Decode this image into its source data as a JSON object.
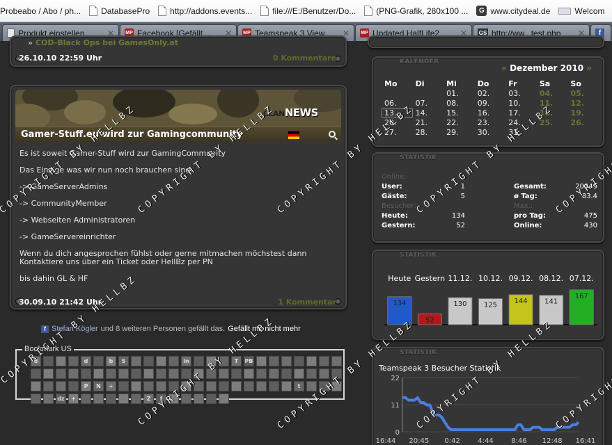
{
  "browser": {
    "bookmarks": [
      {
        "label": "Probeabo / Abo / ph...",
        "icon": "none"
      },
      {
        "label": "DatabasePro",
        "icon": "page"
      },
      {
        "label": "http://addons.events...",
        "icon": "page"
      },
      {
        "label": "file:///E:/Benutzer/Do...",
        "icon": "page"
      },
      {
        "label": "(PNG-Grafik, 280x100 ...",
        "icon": "page"
      },
      {
        "label": "www.citydeal.de",
        "icon": "g"
      },
      {
        "label": "Welcom",
        "icon": "cd"
      }
    ],
    "tabs": [
      {
        "label": "Produkt einstellen...",
        "favicon": "doc-icon"
      },
      {
        "label": "Facebook [Gefällt ...",
        "favicon": "mp-icon"
      },
      {
        "label": "Teamspeak 3 View...",
        "favicon": "mp-icon"
      },
      {
        "label": "Updated HalfLife2...",
        "favicon": "mp-icon"
      },
      {
        "label": "http://ww...test.php",
        "favicon": "gs-icon"
      },
      {
        "label": "",
        "favicon": "fb-icon"
      }
    ]
  },
  "news_top": {
    "link_arrow": "»",
    "link_text": "COD-Black Ops bei GamesOnly.at",
    "date": "26.10.10 22:59 Uhr",
    "comments": "0 Kommentare"
  },
  "news_main": {
    "logo_clan": "CLAN",
    "logo_news": "NEWS",
    "title": "Gamer-Stuff.eu wird zur Gamingcommunity",
    "body": [
      "Es ist soweit Gamer-Stuff wird zur GamingCommunity",
      "Das Einzige was wir nun noch brauchen sind:",
      "-> GameServerAdmins",
      "-> CommunityMember",
      "-> Webseiten Administratoren",
      "-> GameServereinrichter",
      "Wenn du dich angesprochen fühlst oder gerne mitmachen möchstest dann Kontaktiere uns über ein Ticket oder HellBz per PN",
      "bis dahin GL & HF"
    ],
    "date": "30.09.10 21:42 Uhr",
    "comments": "1 Kommentar"
  },
  "facebook": {
    "user": "Stefan Kögler",
    "text": "und 8 weiteren Personen gefällt das.",
    "unlike": "Gefällt mir nicht mehr"
  },
  "bookmark_us": {
    "title": "Bookmark US",
    "icons": [
      "d",
      "",
      "",
      "",
      "d",
      "",
      "b",
      "S",
      "",
      "",
      "",
      "",
      "in",
      "",
      "",
      "",
      "T",
      "PB",
      "",
      "",
      "",
      "",
      "",
      "",
      "",
      "",
      "",
      "",
      "",
      "",
      "",
      "",
      "",
      "",
      "",
      "",
      "",
      "",
      "",
      "",
      "",
      "",
      "",
      "",
      "",
      "",
      "",
      "",
      "",
      "",
      "",
      "",
      "",
      "",
      "P",
      "N",
      "+",
      "",
      "",
      "",
      "",
      "",
      "",
      "",
      "",
      "",
      "",
      "",
      "",
      "",
      "",
      "t",
      "",
      "",
      "",
      "",
      "",
      "dz",
      "+",
      "",
      "",
      "",
      "",
      "",
      "Z",
      "f",
      "",
      "",
      "",
      "",
      ""
    ]
  },
  "calendar": {
    "heading": "KALENDER",
    "prev": "«",
    "month": "Dezember 2010",
    "next": "»",
    "days": [
      "Mo",
      "Di",
      "Mi",
      "Do",
      "Fr",
      "Sa",
      "So"
    ],
    "weeks": [
      [
        "",
        "",
        "01.",
        "02.",
        "03.",
        "04.",
        "05."
      ],
      [
        "06.",
        "07.",
        "08.",
        "09.",
        "10.",
        "11.",
        "12."
      ],
      [
        "13.",
        "14.",
        "15.",
        "16.",
        "17.",
        "18.",
        "19."
      ],
      [
        "20.",
        "21.",
        "22.",
        "23.",
        "24.",
        "25.",
        "26."
      ],
      [
        "27.",
        "28.",
        "29.",
        "30.",
        "31.",
        "",
        ""
      ]
    ]
  },
  "statistik1": {
    "heading": "STATISTIK",
    "online_label": "Online:",
    "user_label": "User:",
    "user": "1",
    "gesamt_label": "Gesamt:",
    "gesamt": "20849",
    "gaeste_label": "Gäste:",
    "gaeste": "5",
    "tag_label": "ø Tag:",
    "tag": "83.4",
    "besucher_label": "Besucher:",
    "max_label": "Max.:",
    "heute_label": "Heute:",
    "heute": "134",
    "protag_label": "pro Tag:",
    "protag": "475",
    "gestern_label": "Gestern:",
    "gestern": "52",
    "maxonline_label": "Online:",
    "maxonline": "430"
  },
  "statistik2": {
    "heading": "STATISTIK"
  },
  "statistik3": {
    "heading": "STATISTIK"
  },
  "chart_data": [
    {
      "type": "bar",
      "categories": [
        "Heute",
        "Gestern",
        "11.12.",
        "10.12.",
        "09.12.",
        "08.12.",
        "07.12."
      ],
      "values": [
        134,
        52,
        130,
        125,
        144,
        141,
        167
      ],
      "colors": [
        "#1e5bc8",
        "#b01a1a",
        "#c8c8c8",
        "#c8c8c8",
        "#c4c41c",
        "#c8c8c8",
        "#22b022"
      ],
      "ylim": [
        0,
        180
      ]
    },
    {
      "type": "line",
      "title": "Teamspeak 3 Besucher Statistik",
      "x_ticks": [
        "16:44",
        "20:45",
        "0:42",
        "4:44",
        "8:46",
        "12:48",
        "16:41"
      ],
      "y_ticks": [
        22,
        11,
        0
      ],
      "ylim": [
        0,
        22
      ],
      "values": [
        13,
        13,
        12,
        12,
        12,
        13,
        11,
        11,
        10,
        10,
        7,
        6,
        6,
        5,
        3,
        1,
        0,
        0,
        0,
        0,
        0,
        0,
        0,
        0,
        0,
        0,
        0,
        0,
        0,
        0,
        0,
        0,
        0,
        0,
        0,
        0,
        0,
        0,
        2,
        2,
        0,
        0,
        0,
        1,
        1,
        1,
        0,
        0,
        0,
        0,
        0,
        1,
        1,
        1,
        1,
        1,
        2,
        2,
        3
      ],
      "line_color": "#4a7fe0"
    }
  ],
  "watermark": "COPYRIGHT BY HELLBZ"
}
